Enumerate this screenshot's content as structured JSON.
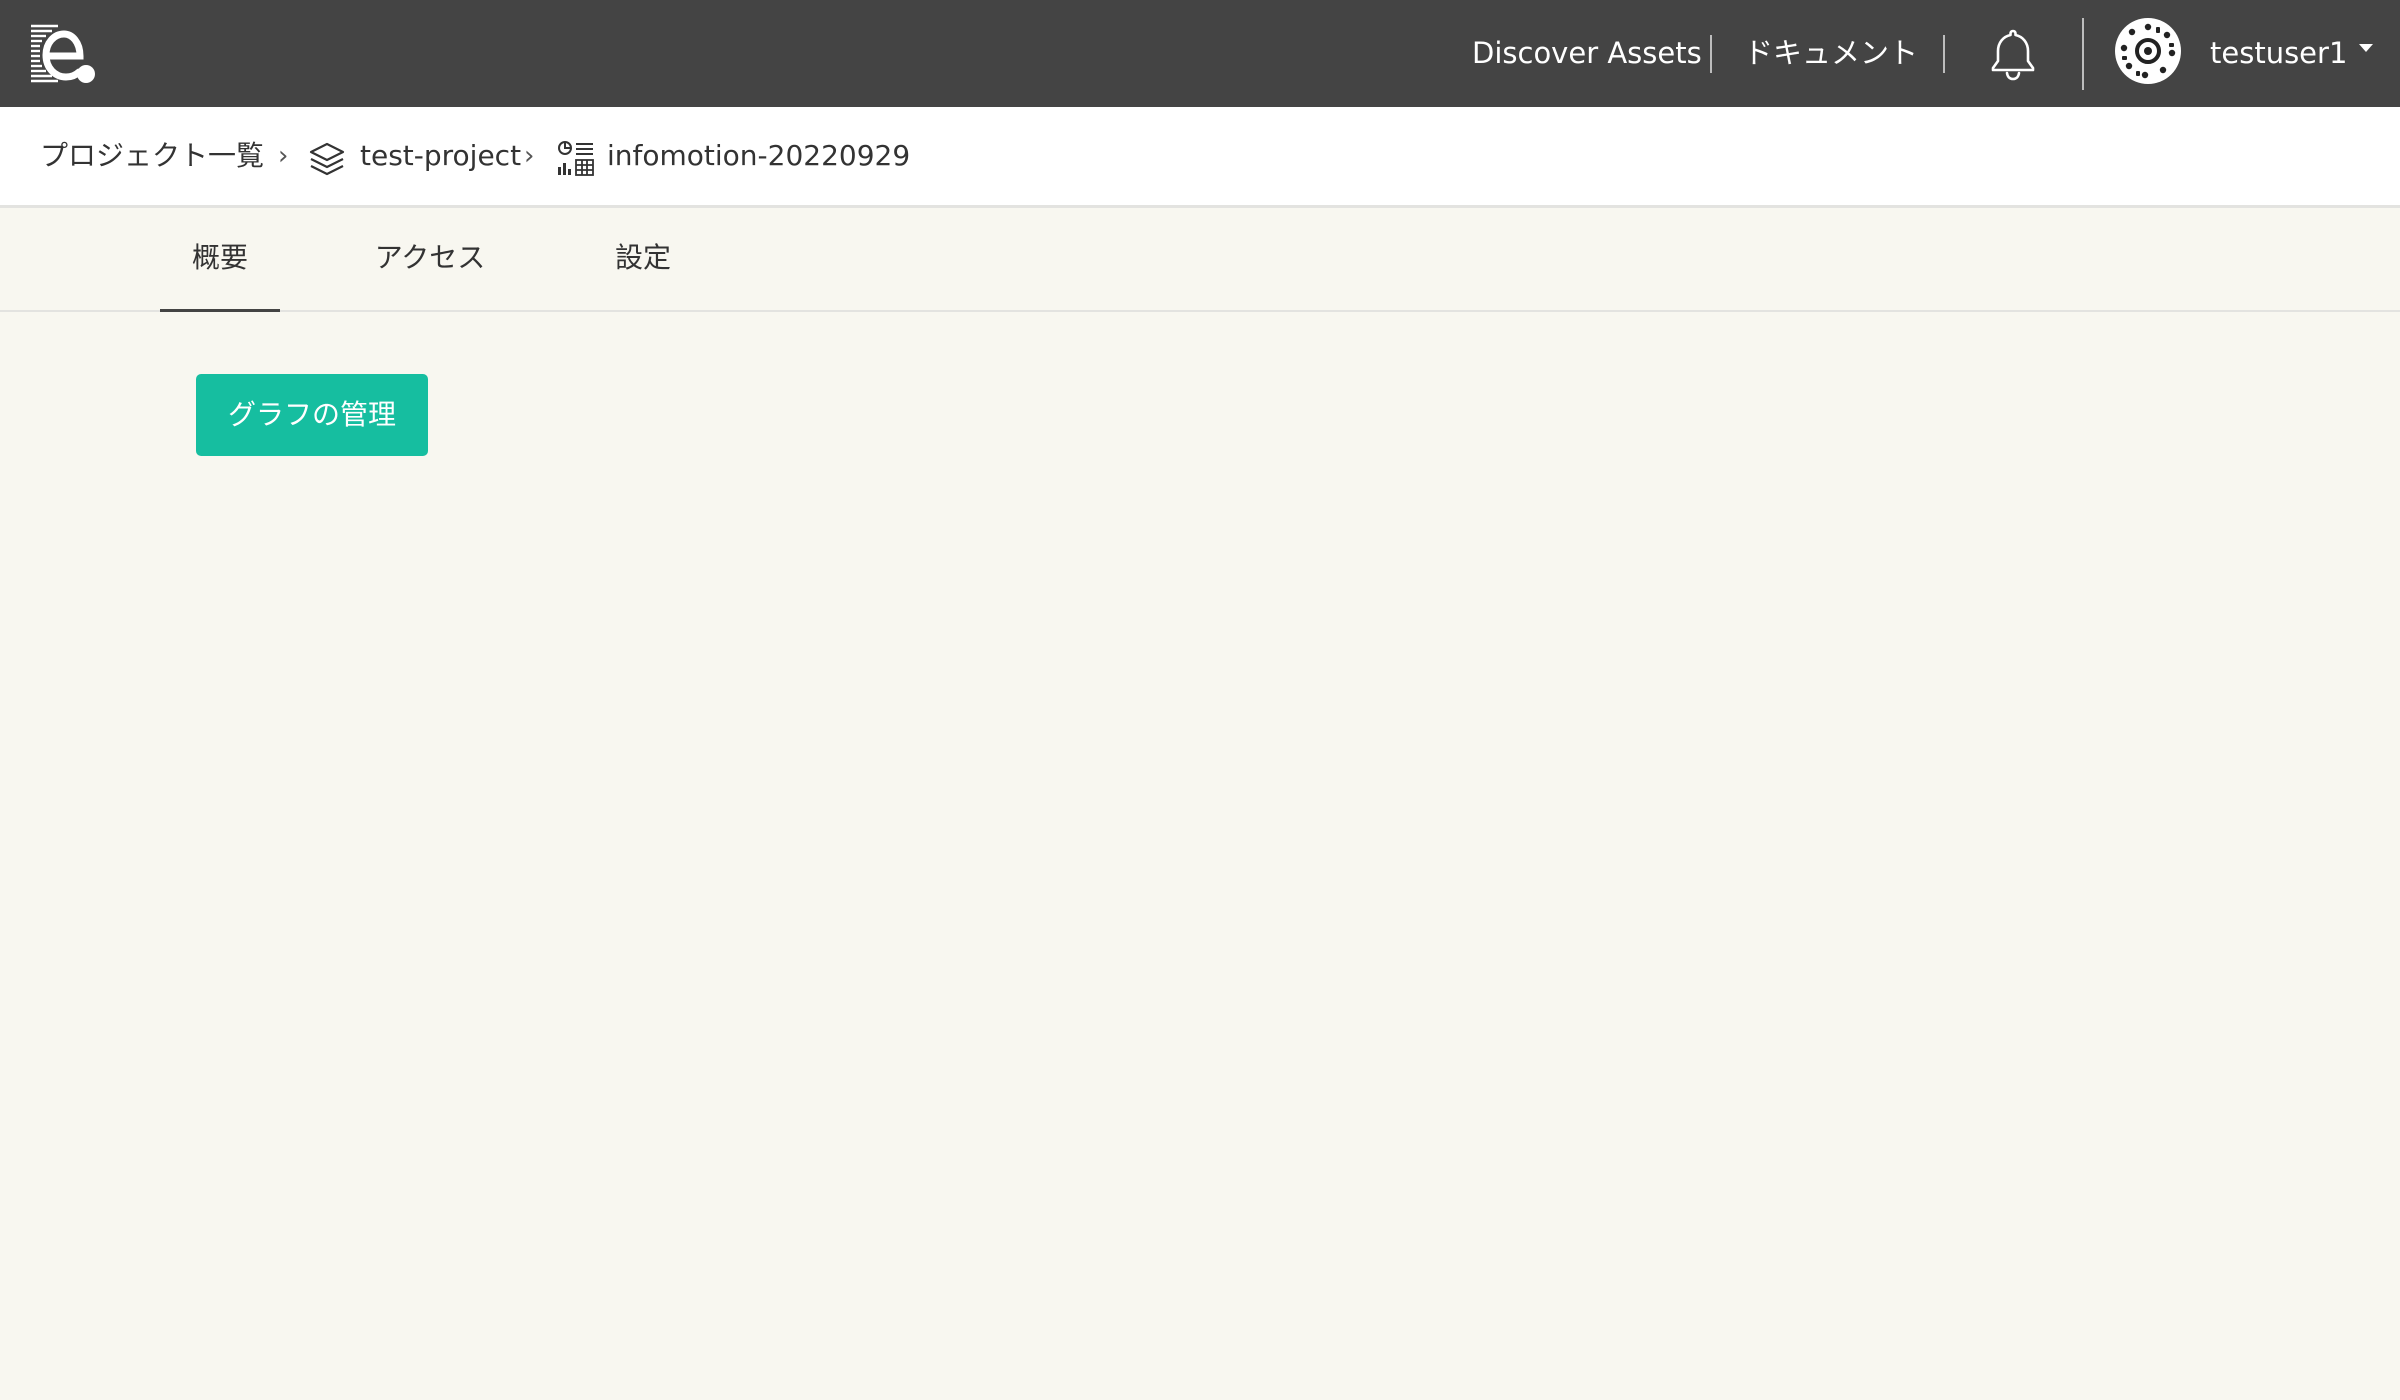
{
  "header": {
    "logo_icon": "app-logo-icon",
    "nav": {
      "discover_assets": "Discover Assets",
      "documents": "ドキュメント"
    },
    "notification_icon": "bell-icon",
    "user": {
      "avatar_icon": "user-avatar-icon",
      "username": "testuser1",
      "menu_icon": "caret-down-icon"
    }
  },
  "breadcrumb": {
    "projects": "プロジェクト一覧",
    "separator": "›",
    "project_icon": "layers-icon",
    "project": "test-project",
    "dataset_icon": "dataset-icon",
    "dataset": "infomotion-20220929"
  },
  "tabs": [
    {
      "label": "概要",
      "active": true
    },
    {
      "label": "アクセス",
      "active": false
    },
    {
      "label": "設定",
      "active": false
    }
  ],
  "main": {
    "manage_graph_button": "グラフの管理"
  },
  "colors": {
    "topbar": "#444444",
    "page_background": "#f8f7f0",
    "primary_button": "#16bea0"
  }
}
